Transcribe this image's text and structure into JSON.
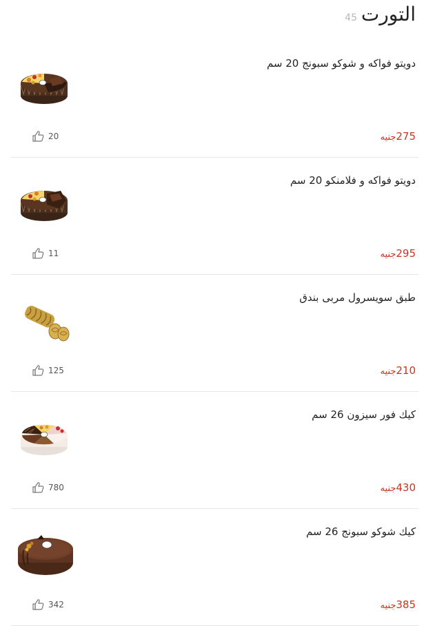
{
  "header": {
    "title": "التورت",
    "count": "45"
  },
  "items": [
    {
      "name": "دويتو فواكه و شوكو سبونج 20 سم",
      "price": "275",
      "currency": "جنيه",
      "likes": "20",
      "image": "duet-fruit-choco-cake"
    },
    {
      "name": "دويتو فواكه و فلامنكو 20 سم",
      "price": "295",
      "currency": "جنيه",
      "likes": "11",
      "image": "duet-fruit-flamenco-cake"
    },
    {
      "name": "طبق سويسرول مربى بندق",
      "price": "210",
      "currency": "جنيه",
      "likes": "125",
      "image": "swiss-roll-jam-hazelnut"
    },
    {
      "name": "كيك فور سيزون 26 سم",
      "price": "430",
      "currency": "جنيه",
      "likes": "780",
      "image": "four-season-cake"
    },
    {
      "name": "كيك شوكو سبونج 26 سم",
      "price": "385",
      "currency": "جنيه",
      "likes": "342",
      "image": "choco-sponge-cake"
    }
  ],
  "colors": {
    "price": "#c8351e",
    "divider": "#e6e6e6",
    "count": "#b8b8b8"
  },
  "icons": {
    "like": "thumbs-up-icon"
  }
}
